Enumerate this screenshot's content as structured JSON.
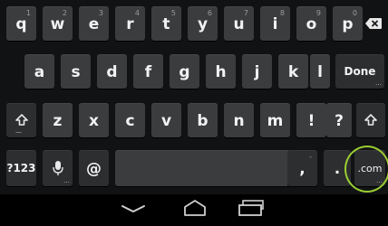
{
  "keyboard": {
    "row1": [
      {
        "label": "q",
        "hint": "1"
      },
      {
        "label": "w",
        "hint": "2"
      },
      {
        "label": "e",
        "hint": "3"
      },
      {
        "label": "r",
        "hint": "4"
      },
      {
        "label": "t",
        "hint": "5"
      },
      {
        "label": "y",
        "hint": "6"
      },
      {
        "label": "u",
        "hint": "7"
      },
      {
        "label": "i",
        "hint": "8"
      },
      {
        "label": "o",
        "hint": "9"
      },
      {
        "label": "p",
        "hint": "0"
      }
    ],
    "row2": [
      "a",
      "s",
      "d",
      "f",
      "g",
      "h",
      "j",
      "k",
      "l"
    ],
    "done_label": "Done",
    "row3": [
      "z",
      "x",
      "c",
      "v",
      "b",
      "n",
      "m",
      "!",
      "?"
    ],
    "symbols_label": "?123",
    "at_label": "@",
    "comma_label": ",",
    "period_label": ".",
    "dotcom_label": ".com",
    "highlight_color": "#9acd32",
    "icons": {
      "backspace": "backspace-icon",
      "shift": "shift-icon",
      "mic": "microphone-icon",
      "back": "back-icon",
      "home": "home-icon",
      "recents": "recent-apps-icon"
    }
  }
}
